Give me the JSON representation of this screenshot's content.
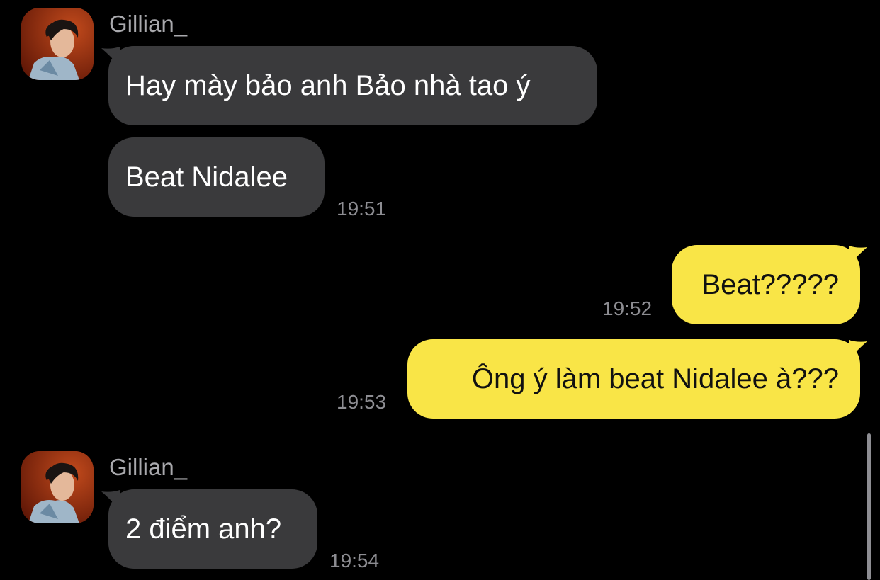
{
  "theme": {
    "background": "#000000",
    "incoming_bubble": "#3a3a3c",
    "outgoing_bubble": "#f9e547",
    "sender_name_color": "#a9a9ad",
    "timestamp_color": "#8d8d92"
  },
  "chat": {
    "groups": [
      {
        "sender": "Gillian_",
        "avatar_icon": "profile-photo",
        "messages": [
          "Hay mày bảo anh Bảo nhà tao ý",
          "Beat Nidalee"
        ],
        "time": "19:51"
      },
      {
        "sender": "me",
        "messages": [
          "Beat?????"
        ],
        "time": "19:52"
      },
      {
        "sender": "me",
        "messages": [
          "Ông ý làm beat Nidalee à???"
        ],
        "time": "19:53"
      },
      {
        "sender": "Gillian_",
        "avatar_icon": "profile-photo",
        "messages": [
          "2 điểm anh?"
        ],
        "time": "19:54"
      }
    ]
  }
}
